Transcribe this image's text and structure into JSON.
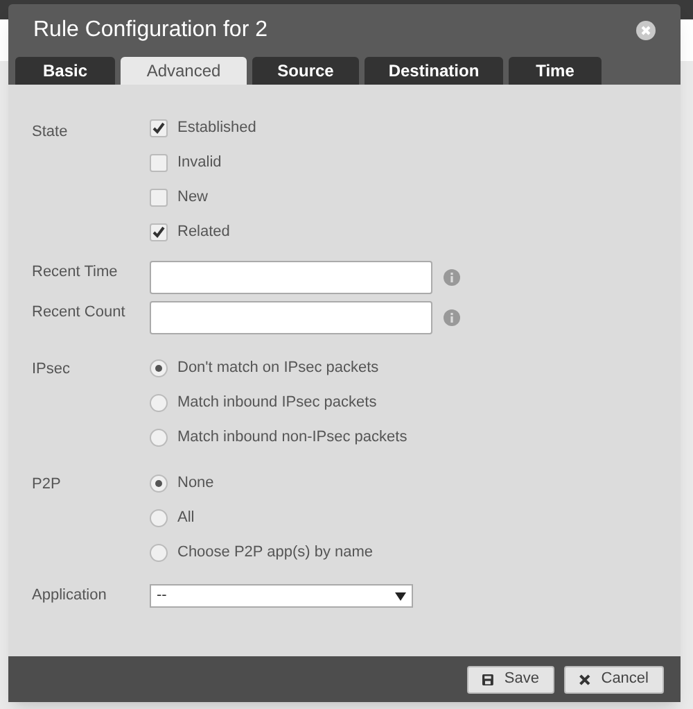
{
  "dialog": {
    "title": "Rule Configuration for 2"
  },
  "tabs": [
    {
      "label": "Basic",
      "selected": false
    },
    {
      "label": "Advanced",
      "selected": true
    },
    {
      "label": "Source",
      "selected": false
    },
    {
      "label": "Destination",
      "selected": false
    },
    {
      "label": "Time",
      "selected": false
    }
  ],
  "state": {
    "label": "State",
    "options": [
      {
        "label": "Established",
        "checked": true
      },
      {
        "label": "Invalid",
        "checked": false
      },
      {
        "label": "New",
        "checked": false
      },
      {
        "label": "Related",
        "checked": true
      }
    ]
  },
  "recent_time": {
    "label": "Recent Time"
  },
  "recent_count": {
    "label": "Recent Count"
  },
  "ipsec": {
    "label": "IPsec",
    "options": [
      {
        "label": "Don't match on IPsec packets",
        "selected": true
      },
      {
        "label": "Match inbound IPsec packets",
        "selected": false
      },
      {
        "label": "Match inbound non-IPsec packets",
        "selected": false
      }
    ]
  },
  "p2p": {
    "label": "P2P",
    "options": [
      {
        "label": "None",
        "selected": true
      },
      {
        "label": "All",
        "selected": false
      },
      {
        "label": "Choose P2P app(s) by name",
        "selected": false
      }
    ]
  },
  "application": {
    "label": "Application",
    "value": "--"
  },
  "buttons": [
    {
      "kind": "save",
      "label": "Save"
    },
    {
      "kind": "cancel",
      "label": "Cancel"
    }
  ]
}
